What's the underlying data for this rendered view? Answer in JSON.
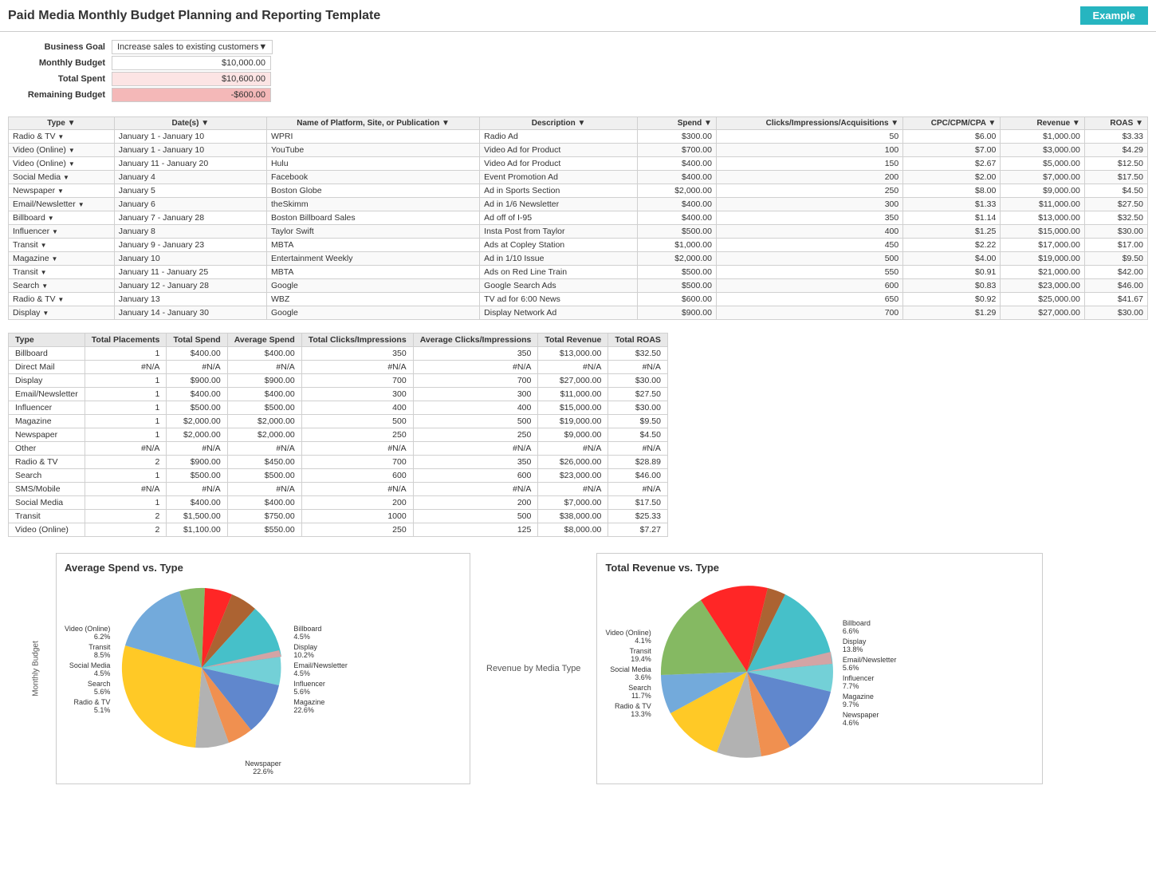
{
  "header": {
    "title": "Paid Media Monthly Budget Planning and Reporting Template",
    "badge": "Example"
  },
  "summary": {
    "business_goal_label": "Business Goal",
    "business_goal_value": "Increase sales to existing customers",
    "monthly_budget_label": "Monthly Budget",
    "monthly_budget_value": "$10,000.00",
    "total_spent_label": "Total Spent",
    "total_spent_value": "$10,600.00",
    "remaining_budget_label": "Remaining Budget",
    "remaining_budget_value": "-$600.00"
  },
  "main_table": {
    "columns": [
      "Type",
      "Date(s)",
      "Name of Platform, Site, or Publication",
      "Description",
      "Spend",
      "Clicks/Impressions/Acquisitions",
      "CPC/CPM/CPA",
      "Revenue",
      "ROAS"
    ],
    "rows": [
      [
        "Radio & TV",
        "January 1 - January 10",
        "WPRI",
        "Radio Ad",
        "$300.00",
        "50",
        "$6.00",
        "$1,000.00",
        "$3.33"
      ],
      [
        "Video (Online)",
        "January 1 - January 10",
        "YouTube",
        "Video Ad for Product",
        "$700.00",
        "100",
        "$7.00",
        "$3,000.00",
        "$4.29"
      ],
      [
        "Video (Online)",
        "January 11 - January 20",
        "Hulu",
        "Video Ad for Product",
        "$400.00",
        "150",
        "$2.67",
        "$5,000.00",
        "$12.50"
      ],
      [
        "Social Media",
        "January 4",
        "Facebook",
        "Event Promotion Ad",
        "$400.00",
        "200",
        "$2.00",
        "$7,000.00",
        "$17.50"
      ],
      [
        "Newspaper",
        "January 5",
        "Boston Globe",
        "Ad in Sports Section",
        "$2,000.00",
        "250",
        "$8.00",
        "$9,000.00",
        "$4.50"
      ],
      [
        "Email/Newsletter",
        "January 6",
        "theSkimm",
        "Ad in 1/6 Newsletter",
        "$400.00",
        "300",
        "$1.33",
        "$11,000.00",
        "$27.50"
      ],
      [
        "Billboard",
        "January 7 - January 28",
        "Boston Billboard Sales",
        "Ad off of I-95",
        "$400.00",
        "350",
        "$1.14",
        "$13,000.00",
        "$32.50"
      ],
      [
        "Influencer",
        "January 8",
        "Taylor Swift",
        "Insta Post from Taylor",
        "$500.00",
        "400",
        "$1.25",
        "$15,000.00",
        "$30.00"
      ],
      [
        "Transit",
        "January 9 - January 23",
        "MBTA",
        "Ads at Copley Station",
        "$1,000.00",
        "450",
        "$2.22",
        "$17,000.00",
        "$17.00"
      ],
      [
        "Magazine",
        "January 10",
        "Entertainment Weekly",
        "Ad in 1/10 Issue",
        "$2,000.00",
        "500",
        "$4.00",
        "$19,000.00",
        "$9.50"
      ],
      [
        "Transit",
        "January 11 - January 25",
        "MBTA",
        "Ads on Red Line Train",
        "$500.00",
        "550",
        "$0.91",
        "$21,000.00",
        "$42.00"
      ],
      [
        "Search",
        "January 12 - January 28",
        "Google",
        "Google Search Ads",
        "$500.00",
        "600",
        "$0.83",
        "$23,000.00",
        "$46.00"
      ],
      [
        "Radio & TV",
        "January 13",
        "WBZ",
        "TV ad for 6:00 News",
        "$600.00",
        "650",
        "$0.92",
        "$25,000.00",
        "$41.67"
      ],
      [
        "Display",
        "January 14 - January 30",
        "Google",
        "Display Network Ad",
        "$900.00",
        "700",
        "$1.29",
        "$27,000.00",
        "$30.00"
      ]
    ]
  },
  "summary_table": {
    "columns": [
      "Type",
      "Total Placements",
      "Total Spend",
      "Average Spend",
      "Total Clicks/Impressions",
      "Average Clicks/Impressions",
      "Total Revenue",
      "Total ROAS"
    ],
    "rows": [
      [
        "Billboard",
        "1",
        "$400.00",
        "$400.00",
        "350",
        "350",
        "$13,000.00",
        "$32.50"
      ],
      [
        "Direct Mail",
        "#N/A",
        "#N/A",
        "#N/A",
        "#N/A",
        "#N/A",
        "#N/A",
        "#N/A"
      ],
      [
        "Display",
        "1",
        "$900.00",
        "$900.00",
        "700",
        "700",
        "$27,000.00",
        "$30.00"
      ],
      [
        "Email/Newsletter",
        "1",
        "$400.00",
        "$400.00",
        "300",
        "300",
        "$11,000.00",
        "$27.50"
      ],
      [
        "Influencer",
        "1",
        "$500.00",
        "$500.00",
        "400",
        "400",
        "$15,000.00",
        "$30.00"
      ],
      [
        "Magazine",
        "1",
        "$2,000.00",
        "$2,000.00",
        "500",
        "500",
        "$19,000.00",
        "$9.50"
      ],
      [
        "Newspaper",
        "1",
        "$2,000.00",
        "$2,000.00",
        "250",
        "250",
        "$9,000.00",
        "$4.50"
      ],
      [
        "Other",
        "#N/A",
        "#N/A",
        "#N/A",
        "#N/A",
        "#N/A",
        "#N/A",
        "#N/A"
      ],
      [
        "Radio & TV",
        "2",
        "$900.00",
        "$450.00",
        "700",
        "350",
        "$26,000.00",
        "$28.89"
      ],
      [
        "Search",
        "1",
        "$500.00",
        "$500.00",
        "600",
        "600",
        "$23,000.00",
        "$46.00"
      ],
      [
        "SMS/Mobile",
        "#N/A",
        "#N/A",
        "#N/A",
        "#N/A",
        "#N/A",
        "#N/A",
        "#N/A"
      ],
      [
        "Social Media",
        "1",
        "$400.00",
        "$400.00",
        "200",
        "200",
        "$7,000.00",
        "$17.50"
      ],
      [
        "Transit",
        "2",
        "$1,500.00",
        "$750.00",
        "1000",
        "500",
        "$38,000.00",
        "$25.33"
      ],
      [
        "Video (Online)",
        "2",
        "$1,100.00",
        "$550.00",
        "250",
        "125",
        "$8,000.00",
        "$7.27"
      ]
    ]
  },
  "charts": {
    "avg_spend_title": "Average Spend vs. Type",
    "revenue_title": "Total Revenue vs. Type",
    "monthly_budget_label": "Monthly Budget",
    "revenue_by_media_label": "Revenue by Media Type",
    "avg_spend_legend_left": [
      {
        "label": "Video (Online)",
        "pct": "6.2%"
      },
      {
        "label": "Transit",
        "pct": "8.5%"
      },
      {
        "label": "Social Media",
        "pct": "4.5%"
      },
      {
        "label": "Search",
        "pct": "5.6%"
      },
      {
        "label": "Radio & TV",
        "pct": "5.1%"
      }
    ],
    "avg_spend_legend_right": [
      {
        "label": "Billboard",
        "pct": "4.5%"
      },
      {
        "label": "Display",
        "pct": "10.2%"
      },
      {
        "label": "Email/Newsletter",
        "pct": "4.5%"
      },
      {
        "label": "Influencer",
        "pct": "5.6%"
      },
      {
        "label": "Magazine",
        "pct": "22.6%"
      }
    ],
    "avg_spend_bottom": {
      "label": "Newspaper",
      "pct": "22.6%"
    },
    "revenue_legend_left": [
      {
        "label": "Video (Online)",
        "pct": "4.1%"
      },
      {
        "label": "Transit",
        "pct": "19.4%"
      },
      {
        "label": "Social Media",
        "pct": "3.6%"
      },
      {
        "label": "Search",
        "pct": "11.7%"
      },
      {
        "label": "Radio & TV",
        "pct": "13.3%"
      }
    ],
    "revenue_legend_right": [
      {
        "label": "Billboard",
        "pct": "6.6%"
      },
      {
        "label": "Display",
        "pct": "13.8%"
      },
      {
        "label": "Email/Newsletter",
        "pct": "5.6%"
      },
      {
        "label": "Influencer",
        "pct": "7.7%"
      },
      {
        "label": "Magazine",
        "pct": "9.7%"
      },
      {
        "label": "Newspaper",
        "pct": "4.6%"
      }
    ]
  }
}
